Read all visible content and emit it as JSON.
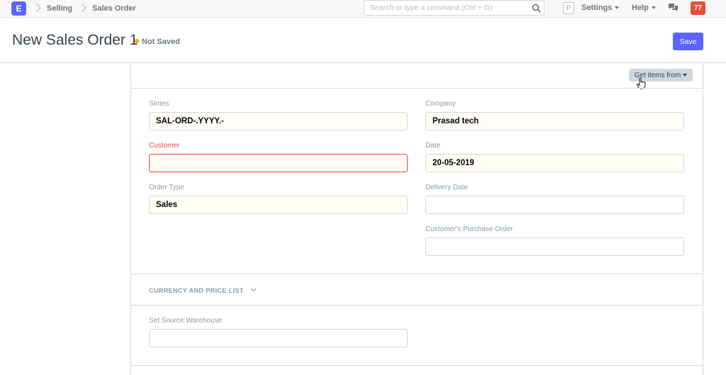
{
  "navbar": {
    "logo_letter": "E",
    "breadcrumbs": [
      "Selling",
      "Sales Order"
    ],
    "search_placeholder": "Search or type a command (Ctrl + G)",
    "profile_letter": "P",
    "settings_label": "Settings",
    "help_label": "Help",
    "notification_count": "77"
  },
  "page": {
    "title": "New Sales Order 1",
    "status": "Not Saved",
    "save_label": "Save"
  },
  "toolbar": {
    "get_items_label": "Get items from"
  },
  "fields": {
    "series": {
      "label": "Series",
      "value": "SAL-ORD-.YYYY.-"
    },
    "customer": {
      "label": "Customer",
      "value": ""
    },
    "order_type": {
      "label": "Order Type",
      "value": "Sales"
    },
    "company": {
      "label": "Company",
      "value": "Prasad tech"
    },
    "date": {
      "label": "Date",
      "value": "20-05-2019"
    },
    "delivery_date": {
      "label": "Delivery Date",
      "value": ""
    },
    "customer_po": {
      "label": "Customer's Purchase Order",
      "value": ""
    },
    "source_warehouse": {
      "label": "Set Source Warehouse",
      "value": ""
    }
  },
  "sections": {
    "currency_price_list": "CURRENCY AND PRICE LIST"
  },
  "colors": {
    "primary": "#5e64ff",
    "indicator_orange": "#ffa00a",
    "error_red": "#e74c3c"
  }
}
